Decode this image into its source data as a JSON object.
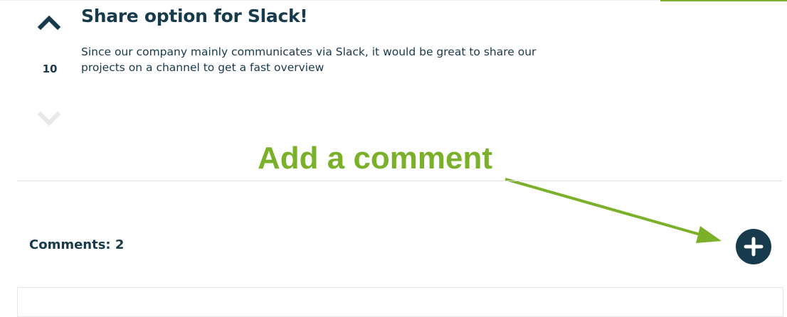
{
  "post": {
    "title": "Share option for Slack!",
    "description": "Since our company mainly communicates via Slack, it would be great to share our projects on a channel to get a fast overview",
    "vote_count": "10",
    "upvote_icon": "chevron-up-icon",
    "downvote_icon": "chevron-down-icon"
  },
  "annotation": {
    "label": "Add a comment"
  },
  "comments": {
    "count_label": "Comments: 2",
    "add_button_icon": "plus-icon"
  },
  "colors": {
    "primary": "#173a4c",
    "accent": "#7ab02a",
    "muted_icon": "#e6e8ea"
  }
}
